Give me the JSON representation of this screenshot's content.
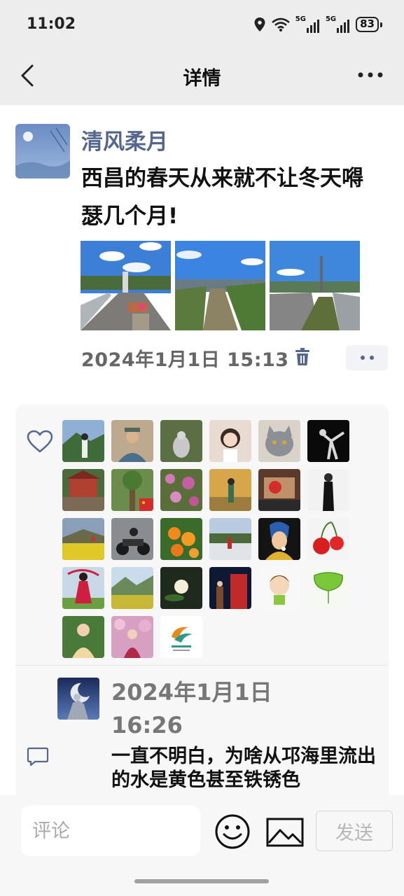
{
  "status_bar": {
    "time": "11:02",
    "net1": "5G",
    "net2": "5G",
    "battery": "83"
  },
  "nav": {
    "title": "详情",
    "back_icon": "chevron-left-icon",
    "more_icon": "more-dots-icon"
  },
  "post": {
    "author": "清风柔月",
    "text": "西昌的春天从来就不让冬天嘚瑟几个月!",
    "time": "2024年1月1日 15:13",
    "photos": [
      "street-bridge-photo",
      "river-photo",
      "road-bridge-photo"
    ]
  },
  "likes": {
    "icon": "heart-icon",
    "avatars": [
      "avatar-mountain-person",
      "avatar-man-hat",
      "avatar-bird",
      "avatar-girl-selfie",
      "avatar-cat",
      "avatar-dancer",
      "avatar-red-building",
      "avatar-tree",
      "avatar-pink-flowers",
      "avatar-autumn-woman",
      "avatar-car",
      "avatar-woman-black",
      "avatar-rapeseed-field",
      "avatar-motorcycle",
      "avatar-oranges",
      "avatar-lakeside",
      "avatar-pearl-earring-girl",
      "avatar-cherries",
      "avatar-red-dress-woman",
      "avatar-landscape",
      "avatar-white-flower",
      "avatar-building-night",
      "avatar-cartoon-boy",
      "avatar-ginkgo-leaf",
      "avatar-woman-yellow",
      "avatar-woman-cherry-blossom",
      "avatar-travel-logo"
    ]
  },
  "comment": {
    "icon": "comment-bubble-icon",
    "time": "2024年1月1日 16:26",
    "text": "一直不明白，为啥从邛海里流出的水是黄色甚至铁锈色"
  },
  "input": {
    "placeholder": "评论",
    "send_label": "发送",
    "emoji_icon": "emoji-icon",
    "image_icon": "image-icon"
  },
  "colors": {
    "accent": "#56678f",
    "background": "#ededed",
    "card": "#f7f7f7"
  }
}
